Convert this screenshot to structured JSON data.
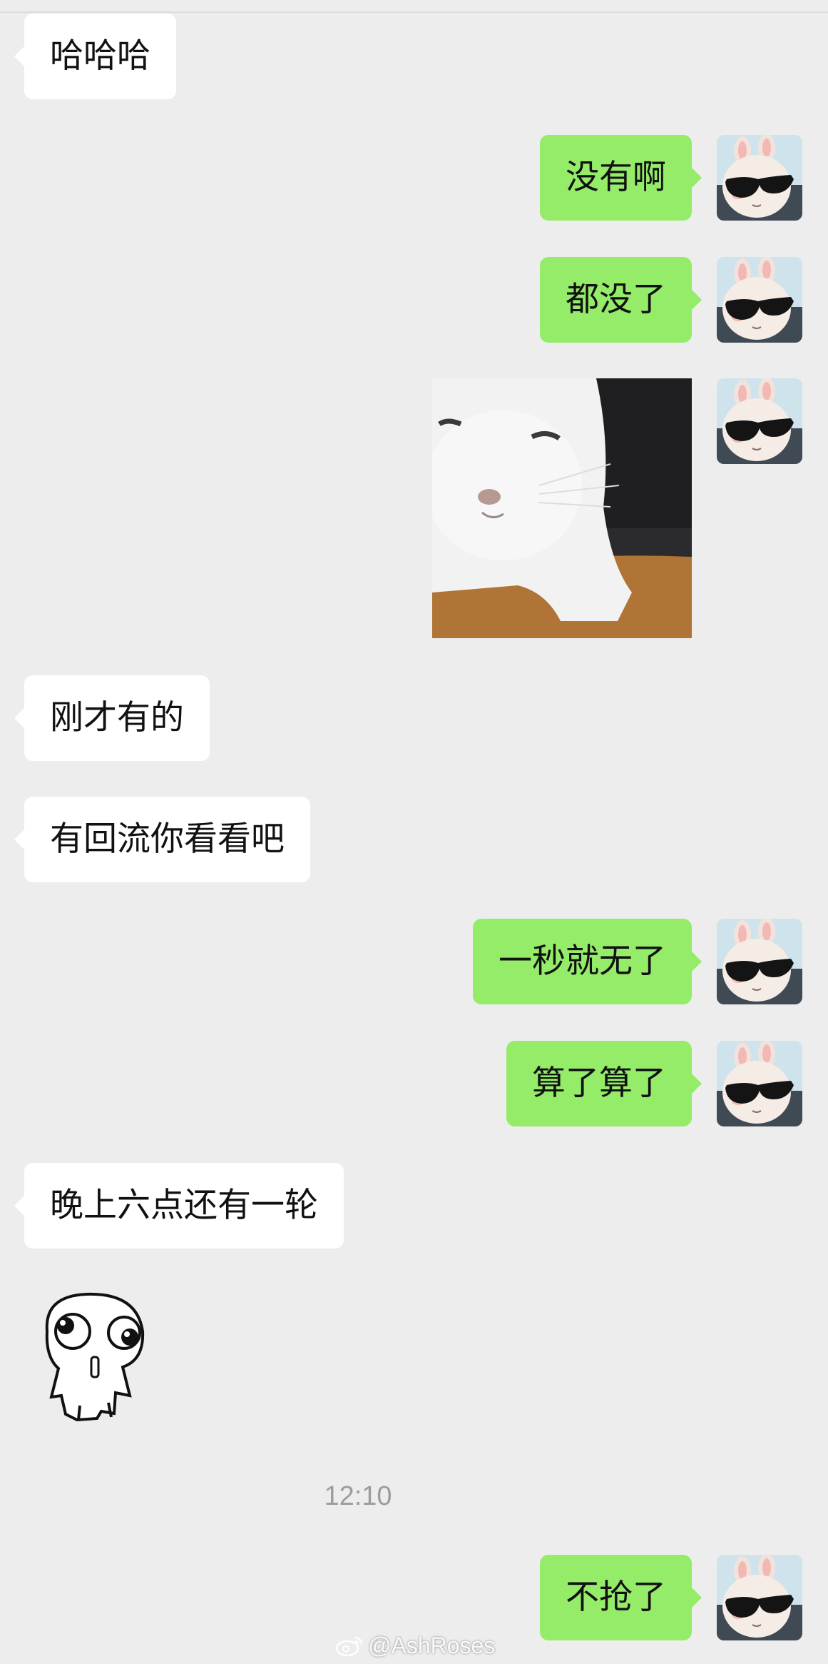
{
  "messages": [
    {
      "side": "in",
      "text": "哈哈哈"
    },
    {
      "side": "out",
      "text": "没有啊"
    },
    {
      "side": "out",
      "text": "都没了"
    },
    {
      "side": "out",
      "kind": "image",
      "icon": "smug-cat-photo"
    },
    {
      "side": "in",
      "text": "刚才有的"
    },
    {
      "side": "in",
      "text": "有回流你看看吧"
    },
    {
      "side": "out",
      "text": "一秒就无了"
    },
    {
      "side": "out",
      "text": "算了算了"
    },
    {
      "side": "in",
      "text": "晚上六点还有一轮"
    },
    {
      "side": "in",
      "kind": "sticker",
      "icon": "wide-eyed-cartoon-sticker"
    },
    {
      "side": "out",
      "text": "不抢了"
    }
  ],
  "timestamp": "12:10",
  "watermark": {
    "icon": "weibo-icon",
    "text": "@AshRoses"
  },
  "avatar_icon": "bunny-sunglasses-avatar",
  "colors": {
    "background": "#ededed",
    "incoming": "#ffffff",
    "outgoing": "#95ec69"
  }
}
